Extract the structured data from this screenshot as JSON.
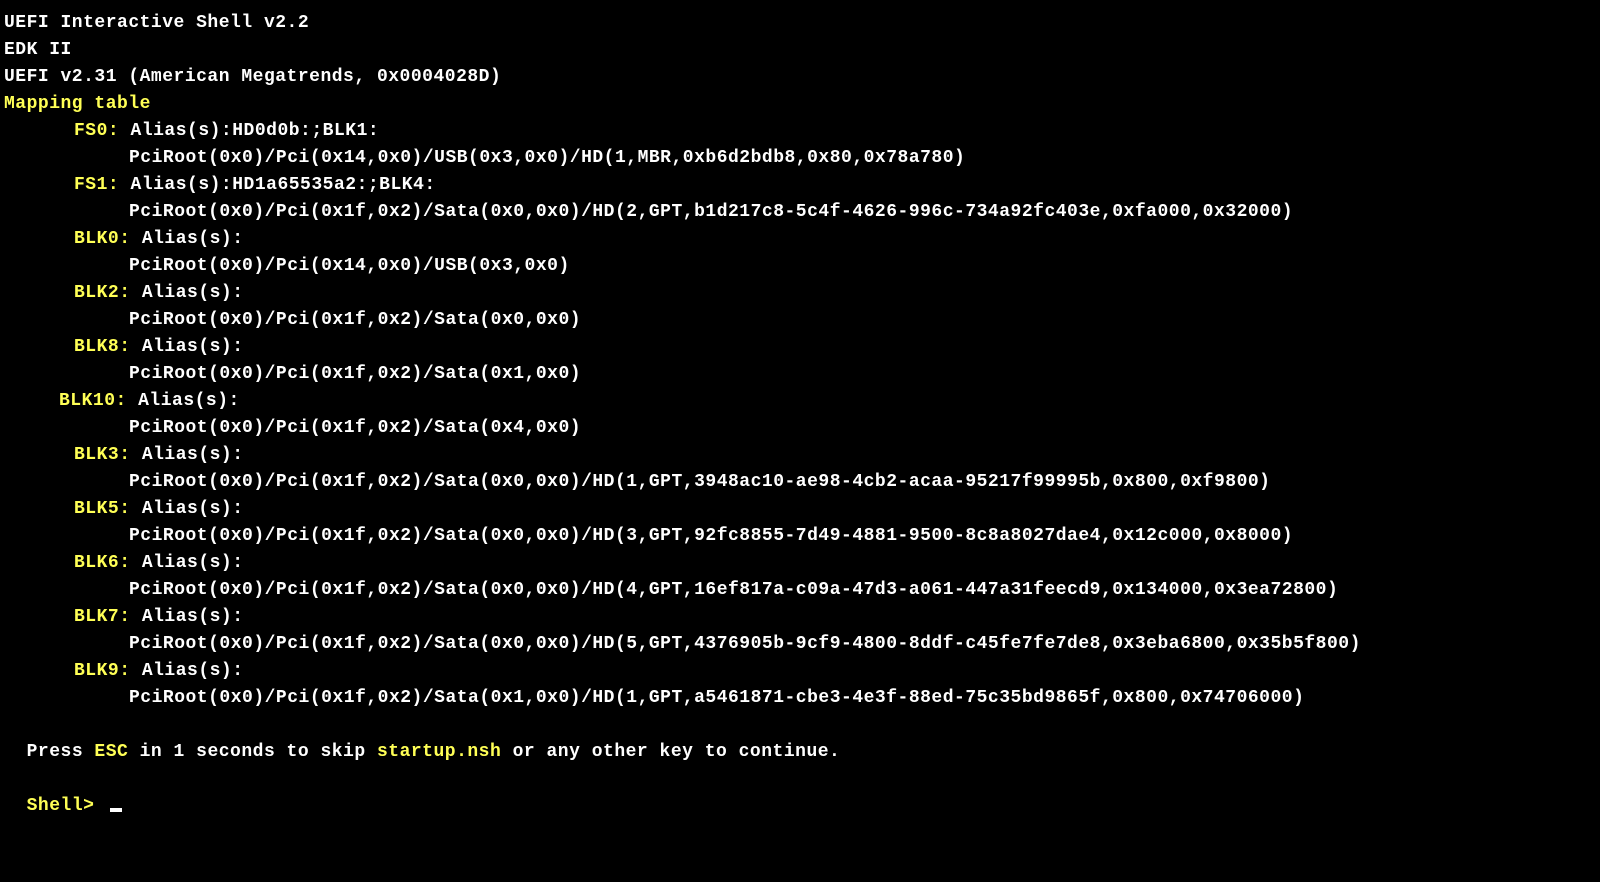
{
  "header": {
    "title": "UEFI Interactive Shell v2.2",
    "edk": "EDK II",
    "version": "UEFI v2.31 (American Megatrends, 0x0004028D)",
    "mapping_label": "Mapping table"
  },
  "mappings": [
    {
      "name": "FS0:",
      "alias_label": " Alias(s):",
      "alias": "HD0d0b:;BLK1:",
      "path": "PciRoot(0x0)/Pci(0x14,0x0)/USB(0x3,0x0)/HD(1,MBR,0xb6d2bdb8,0x80,0x78a780)",
      "indent": "indent1"
    },
    {
      "name": "FS1:",
      "alias_label": " Alias(s):",
      "alias": "HD1a65535a2:;BLK4:",
      "path": "PciRoot(0x0)/Pci(0x1f,0x2)/Sata(0x0,0x0)/HD(2,GPT,b1d217c8-5c4f-4626-996c-734a92fc403e,0xfa000,0x32000)",
      "indent": "indent1"
    },
    {
      "name": "BLK0:",
      "alias_label": " Alias(s):",
      "alias": "",
      "path": "PciRoot(0x0)/Pci(0x14,0x0)/USB(0x3,0x0)",
      "indent": "indent1"
    },
    {
      "name": "BLK2:",
      "alias_label": " Alias(s):",
      "alias": "",
      "path": "PciRoot(0x0)/Pci(0x1f,0x2)/Sata(0x0,0x0)",
      "indent": "indent1"
    },
    {
      "name": "BLK8:",
      "alias_label": " Alias(s):",
      "alias": "",
      "path": "PciRoot(0x0)/Pci(0x1f,0x2)/Sata(0x1,0x0)",
      "indent": "indent1"
    },
    {
      "name": "BLK10:",
      "alias_label": " Alias(s):",
      "alias": "",
      "path": "PciRoot(0x0)/Pci(0x1f,0x2)/Sata(0x4,0x0)",
      "indent": "indent2"
    },
    {
      "name": "BLK3:",
      "alias_label": " Alias(s):",
      "alias": "",
      "path": "PciRoot(0x0)/Pci(0x1f,0x2)/Sata(0x0,0x0)/HD(1,GPT,3948ac10-ae98-4cb2-acaa-95217f99995b,0x800,0xf9800)",
      "indent": "indent1"
    },
    {
      "name": "BLK5:",
      "alias_label": " Alias(s):",
      "alias": "",
      "path": "PciRoot(0x0)/Pci(0x1f,0x2)/Sata(0x0,0x0)/HD(3,GPT,92fc8855-7d49-4881-9500-8c8a8027dae4,0x12c000,0x8000)",
      "indent": "indent1"
    },
    {
      "name": "BLK6:",
      "alias_label": " Alias(s):",
      "alias": "",
      "path": "PciRoot(0x0)/Pci(0x1f,0x2)/Sata(0x0,0x0)/HD(4,GPT,16ef817a-c09a-47d3-a061-447a31feecd9,0x134000,0x3ea72800)",
      "indent": "indent1"
    },
    {
      "name": "BLK7:",
      "alias_label": " Alias(s):",
      "alias": "",
      "path": "PciRoot(0x0)/Pci(0x1f,0x2)/Sata(0x0,0x0)/HD(5,GPT,4376905b-9cf9-4800-8ddf-c45fe7fe7de8,0x3eba6800,0x35b5f800)",
      "indent": "indent1"
    },
    {
      "name": "BLK9:",
      "alias_label": " Alias(s):",
      "alias": "",
      "path": "PciRoot(0x0)/Pci(0x1f,0x2)/Sata(0x1,0x0)/HD(1,GPT,a5461871-cbe3-4e3f-88ed-75c35bd9865f,0x800,0x74706000)",
      "indent": "indent1"
    }
  ],
  "footer": {
    "press": "Press ",
    "esc": "ESC",
    "mid": " in 1 seconds to skip ",
    "startup": "startup.nsh",
    "end": " or any other key to continue.",
    "prompt": "Shell> "
  }
}
